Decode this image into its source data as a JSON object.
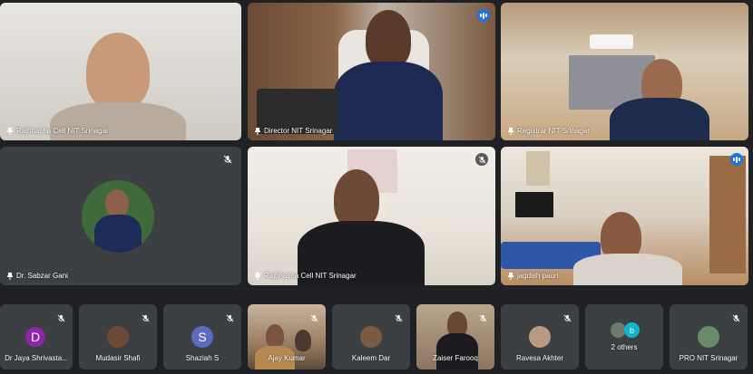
{
  "colors": {
    "background": "#202124",
    "tile": "#3c4043",
    "accent": "#1a73e8",
    "active_border": "#8ab4f8",
    "avatar_d": "#8e24aa",
    "avatar_s": "#5c6bc0",
    "avatar_b": "#12b5cb"
  },
  "main_tiles": [
    {
      "name": "Rajbhasha Cell NIT Srinagar",
      "pinned": true,
      "mic": "none"
    },
    {
      "name": "Director NIT Srinagar",
      "pinned": true,
      "mic": "speaking"
    },
    {
      "name": "Registrar NIT Srinagar",
      "pinned": true,
      "mic": "none"
    },
    {
      "name": "Dr. Sabzar Gani",
      "pinned": true,
      "mic": "muted"
    },
    {
      "name": "Rajbhasha Cell NIT Srinagar",
      "pinned": true,
      "mic": "muted"
    },
    {
      "name": "jagdish pauri",
      "pinned": true,
      "mic": "speaking"
    }
  ],
  "bottom_tiles": [
    {
      "name": "Dr Jaya Shrivasta...",
      "avatar": "D"
    },
    {
      "name": "Mudasir Shafi",
      "avatar": ""
    },
    {
      "name": "Shaziah S",
      "avatar": "S"
    },
    {
      "name": "Ajay Kumar",
      "avatar": ""
    },
    {
      "name": "Kaleem Dar",
      "avatar": ""
    },
    {
      "name": "Zaiser Farooq",
      "avatar": ""
    },
    {
      "name": "Ravesa Akhter",
      "avatar": ""
    },
    {
      "name": "2 others",
      "avatar": "b"
    },
    {
      "name": "PRO NIT Srinagar",
      "avatar": ""
    }
  ],
  "icons": {
    "mic_off": "mic-off-icon",
    "pin": "pin-icon",
    "speaking": "audio-level-icon"
  }
}
